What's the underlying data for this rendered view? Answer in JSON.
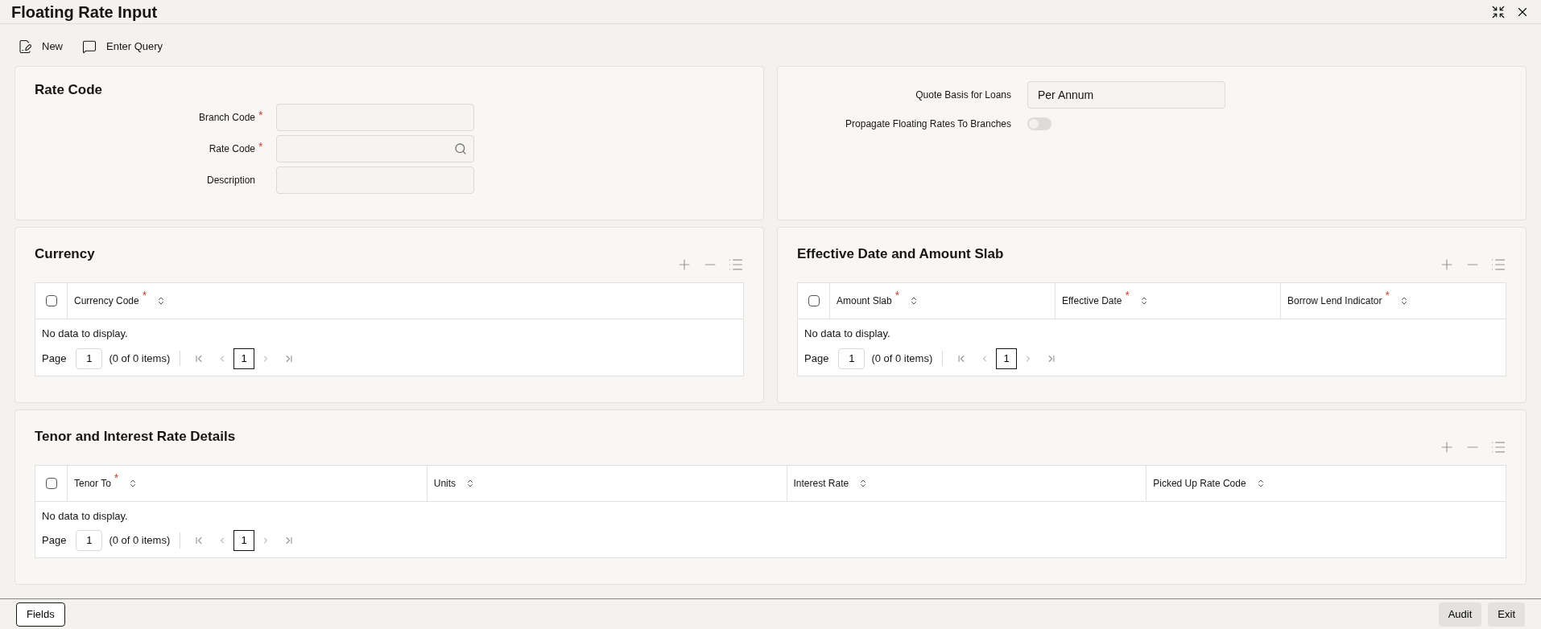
{
  "window": {
    "title": "Floating Rate Input"
  },
  "toolbar": [
    {
      "kind": "new",
      "label": "New"
    },
    {
      "kind": "query",
      "label": "Enter Query"
    }
  ],
  "rate_code": {
    "title": "Rate Code",
    "fields": [
      {
        "label": "Branch Code",
        "required_mark": "*",
        "kind": "text"
      },
      {
        "label": "Rate Code",
        "required_mark": "*",
        "kind": "search"
      },
      {
        "label": "Description",
        "kind": "text"
      }
    ]
  },
  "settings": {
    "fields": [
      {
        "kind": "text",
        "label": "Quote Basis for Loans",
        "value": "Per Annum"
      },
      {
        "kind": "toggle",
        "label": "Propagate Floating Rates To Branches",
        "on": false
      }
    ]
  },
  "grids": [
    {
      "title": "Currency",
      "select_all": {
        "checked": false
      },
      "columns": [
        {
          "label": "Currency Code",
          "required_mark": "*"
        }
      ],
      "empty": "No data to display.",
      "pager": {
        "page_label": "Page",
        "page": "1",
        "items": "(0 of 0 items)",
        "current": "1"
      }
    },
    {
      "title": "Effective Date and Amount Slab",
      "select_all": {
        "checked": false
      },
      "columns": [
        {
          "label": "Amount Slab",
          "required_mark": "*"
        },
        {
          "label": "Effective Date",
          "required_mark": "*"
        },
        {
          "label": "Borrow Lend Indicator",
          "required_mark": "*"
        }
      ],
      "empty": "No data to display.",
      "pager": {
        "page_label": "Page",
        "page": "1",
        "items": "(0 of 0 items)",
        "current": "1"
      }
    },
    {
      "title": "Tenor and Interest Rate Details",
      "select_all": {
        "checked": false
      },
      "columns": [
        {
          "label": "Tenor To",
          "required_mark": "*"
        },
        {
          "label": "Units"
        },
        {
          "label": "Interest Rate"
        },
        {
          "label": "Picked Up Rate Code"
        }
      ],
      "empty": "No data to display.",
      "pager": {
        "page_label": "Page",
        "page": "1",
        "items": "(0 of 0 items)",
        "current": "1"
      }
    }
  ],
  "footer": {
    "left": [
      "Fields"
    ],
    "right": [
      "Audit",
      "Exit"
    ]
  }
}
